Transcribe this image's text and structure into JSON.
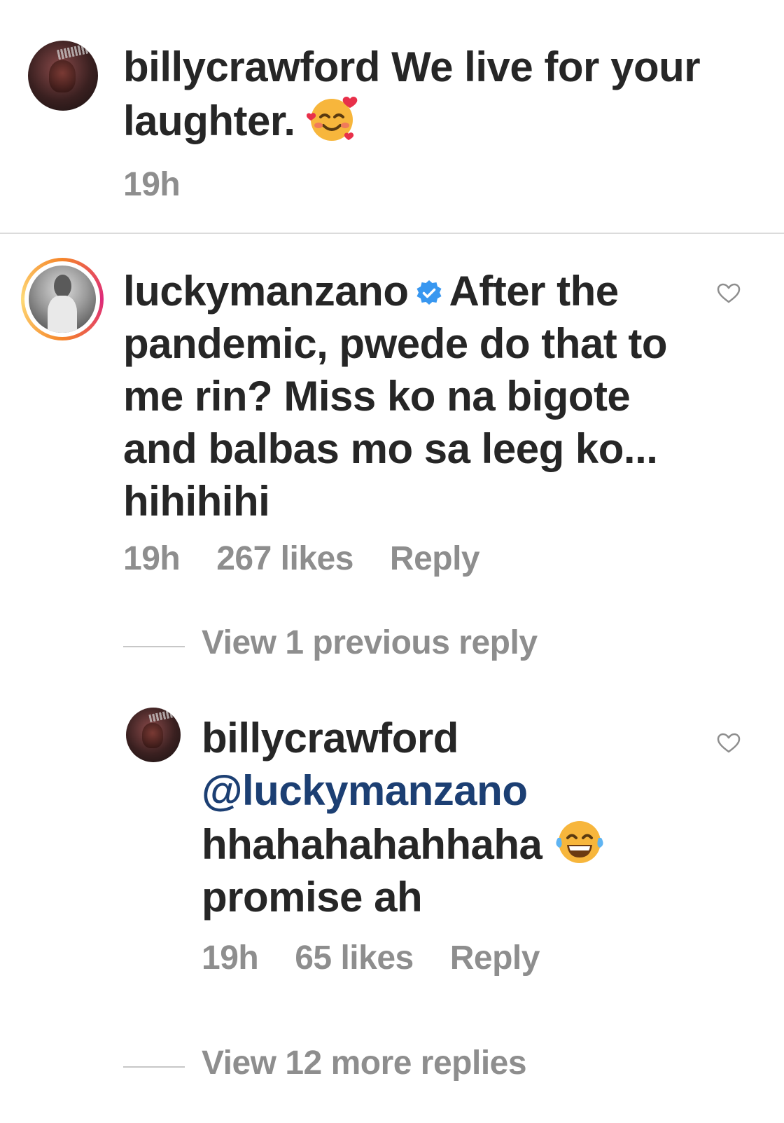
{
  "comments": [
    {
      "username": "billycrawford",
      "text_part1": "We live for your",
      "text_part2": "laughter.",
      "emoji": "smiling-face-with-hearts-icon",
      "time": "19h"
    },
    {
      "username": "luckymanzano",
      "verified": true,
      "line1": "After the",
      "line2": "pandemic, pwede do that to",
      "line3": "me rin? Miss ko na bigote",
      "line4": "and balbas mo sa leeg ko...",
      "line5": "hihihihi",
      "time": "19h",
      "likes": "267 likes",
      "reply": "Reply"
    }
  ],
  "view_previous": "View 1 previous reply",
  "reply_comment": {
    "username": "billycrawford",
    "mention": "@luckymanzano",
    "line1": "hhahahahahhaha",
    "emoji": "face-with-tears-of-joy-icon",
    "line2": "promise ah",
    "time": "19h",
    "likes": "65 likes",
    "reply": "Reply"
  },
  "view_more": "View 12 more replies"
}
